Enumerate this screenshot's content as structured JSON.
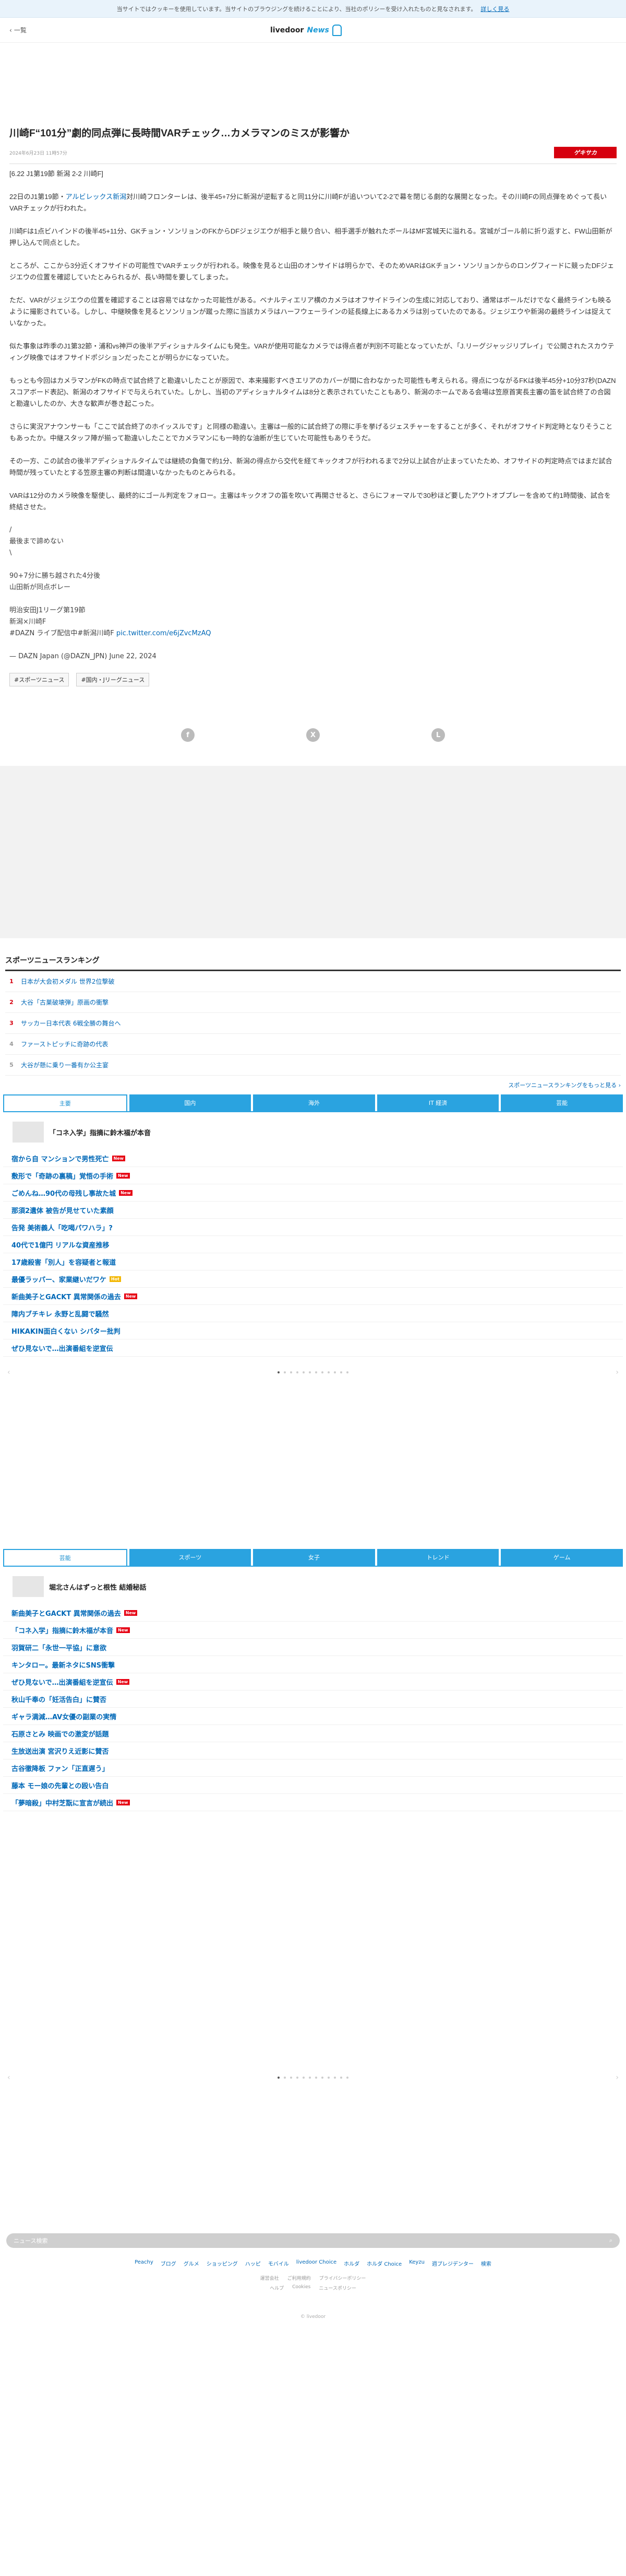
{
  "cookie": {
    "text": "当サイトではクッキーを使用しています。当サイトのブラウジングを続けることにより、当社のポリシーを受け入れたものと見なされます。",
    "link": "詳しく見る"
  },
  "header": {
    "back": "一覧",
    "brand": "livedoor",
    "brand_news": "News"
  },
  "article": {
    "title": "川崎F“101分”劇的同点弾に長時間VARチェック…カメラマンのミスが影響か",
    "date": "2024年6月23日 11時57分",
    "source": "ゲキサカ",
    "lead": "[6.22 J1第19節 新潟 2-2 川崎F]",
    "p1_pre": "22日のJ1第19節・",
    "p1_link": "アルビレックス新潟",
    "p1_post": "対川崎フロンターレは、後半45+7分に新潟が逆転すると同11分に川崎Fが追いついて2-2で幕を閉じる劇的な展開となった。その川崎Fの同点弾をめぐって長いVARチェックが行われた。",
    "p2": "川崎Fは1点ビハインドの後半45+11分、GKチョン・ソンリョンのFKからDFジェジエウが相手と競り合い、相手選手が触れたボールはMF宮城天に溢れる。宮城がゴール前に折り返すと、FW山田新が押し込んで同点とした。",
    "p3": "ところが、ここから3分近くオフサイドの可能性でVARチェックが行われる。映像を見ると山田のオンサイドは明らかで、そのためVARはGKチョン・ソンリョンからのロングフィードに競ったDFジェジエウの位置を確認していたとみられるが、長い時間を要してしまった。",
    "p4": "ただ、VARがジェジエウの位置を確認することは容易ではなかった可能性がある。ベナルティエリア横のカメラはオフサイドラインの生成に対応しており、通常はボールだけでなく最終ラインも映るように撮影されている。しかし、中継映像を見るとソンリョンが蹴った際に当該カメラはハーフウェーラインの延長線上にあるカメラは別っていたのである。ジェジエウや新潟の最終ラインは捉えていなかった。",
    "p5": "似た事象は昨季のJ1第32節・浦和vs神戸の後半アディショナルタイムにも発生。VARが使用可能なカメラでは得点者が判別不可能となっていたが、「J.リーグジャッジリプレイ」で公開されたスカウティング映像ではオフサイドポジションだったことが明らかになっていた。",
    "p6": "もっとも今回はカメラマンがFKの時点で試合終了と勘違いしたことが原因で、本来撮影すべきエリアのカバーが間に合わなかった可能性も考えられる。得点につながるFKは後半45分+10分37秒(DAZNスコアボード表記)、新潟のオフサイドで与えられていた。しかし、当初のアディショナルタイムは8分と表示されていたこともあり、新潟のホームである会場は笠原首実長主審の笛を試合終了の合図と勘違いしたのか、大きな歓声が巻き起こった。",
    "p7": "さらに実況アナウンサーも「ここで試合終了のホイッスルです」と同様の勘違い。主審は一般的に試合終了の際に手を挙げるジェスチャーをすることが多く、それがオフサイド判定時となりそうこともあったか。中継スタッフ陣が揃って勘違いしたことでカメラマンにも一時的な油断が生じていた可能性もありそうだ。",
    "p8": "その一方、この試合の後半アディショナルタイムでは継続の負傷で約1分、新潟の得点から交代を経てキックオフが行われるまで2分以上試合が止まっていたため、オフサイドの判定時点ではまだ試合時間が残っていたとする笠原主審の判断は間違いなかったものとみられる。",
    "p9": "VARは12分のカメラ映像を駆使し、最終的にゴール判定をフォロー。主審はキックオフの笛を吹いて再開させると、さらにフォーマルで30秒ほど要したアウトオブプレーを含めて約1時間後、試合を終結させた。",
    "tweet_l1": "/",
    "tweet_l2": "最後まで諦めない",
    "tweet_l3": "\\",
    "tweet_l4": "90+7分に勝ち越された4分後",
    "tweet_l5": "山田新が同点ボレー",
    "tweet_l6": "明治安田J1リーグ第19節",
    "tweet_l7": "新潟×川崎F",
    "tweet_l8_pre": "#DAZN ライブ配信中#新潟川崎F ",
    "tweet_l8_link": "pic.twitter.com/e6jZvcMzAQ",
    "tweet_l9": "— DAZN Japan (@DAZN_JPN) June 22, 2024",
    "tags": [
      "#スポーツニュース",
      "#国内・Jリーグニュース"
    ]
  },
  "share": {
    "fb": "f",
    "x": "X",
    "line": "L"
  },
  "ranking": {
    "title": "スポーツニュースランキング",
    "items": [
      {
        "no": "1",
        "text": "日本が大会初メダル 世界2位撃破"
      },
      {
        "no": "2",
        "text": "大谷「古巣破壊弾」原画の衝撃"
      },
      {
        "no": "3",
        "text": "サッカー日本代表 6戦全勝の舞台へ"
      },
      {
        "no": "4",
        "text": "ファーストピッチに奇跡の代表"
      },
      {
        "no": "5",
        "text": "大谷が懸に乗り一番有か公主宴"
      }
    ],
    "more": "スポーツニュースランキングをもっと見る ›"
  },
  "tabs1": [
    "主要",
    "国内",
    "海外",
    "IT 経済",
    "芸能"
  ],
  "topics1": {
    "head": "「コネ入学」指摘に鈴木福が本音",
    "items": [
      {
        "text": "宿から自 マンションで男性死亡",
        "badge": "new"
      },
      {
        "text": "敷形で「奇跡の裏稿」覚悟の手術",
        "badge": "new"
      },
      {
        "text": "ごめんね…90代の母残し事故た城",
        "badge": "new"
      },
      {
        "text": "那須2遺体 被告が見せていた素顔",
        "badge": ""
      },
      {
        "text": "告発 美術義人「吃喝パワハラ」?",
        "badge": ""
      },
      {
        "text": "40代で1億円 リアルな資産推移",
        "badge": ""
      },
      {
        "text": "17歳殺害「別人」を容疑者と報道",
        "badge": ""
      },
      {
        "text": "最優ラッパー、家業継いだワケ",
        "badge": "hot"
      },
      {
        "text": "新曲美子とGACKT 異常関係の過去",
        "badge": "new"
      },
      {
        "text": "障内ブチキレ 永野と乱闘で騒然",
        "badge": ""
      },
      {
        "text": "HIKAKIN面白くない シバター批判",
        "badge": ""
      },
      {
        "text": "ぜひ見ないで…出演番組を逆宣伝",
        "badge": ""
      }
    ]
  },
  "tabs2": [
    "芸能",
    "スポーツ",
    "女子",
    "トレンド",
    "ゲーム"
  ],
  "topics2": {
    "head": "堀北さんはずっと根性 結婚秘話",
    "items": [
      {
        "text": "新曲美子とGACKT 異常関係の過去",
        "badge": "new"
      },
      {
        "text": "「コネ入学」指摘に鈴木福が本音",
        "badge": "new"
      },
      {
        "text": "羽賀研二「永世一平協」に意欲",
        "badge": ""
      },
      {
        "text": "キンタロー。最新ネタにSNS衝撃",
        "badge": ""
      },
      {
        "text": "ぜひ見ないで…出演番組を逆宣伝",
        "badge": "new"
      },
      {
        "text": "秋山千奉の「妊活告白」に賛否",
        "badge": ""
      },
      {
        "text": "ギャラ満減…AV女優の副業の実情",
        "badge": ""
      },
      {
        "text": "石原さとみ 映画での激変が話題",
        "badge": ""
      },
      {
        "text": "生放送出演 宮沢りえ近影に賛否",
        "badge": ""
      },
      {
        "text": "古谷徹降板 ファン「正直遅う」",
        "badge": ""
      },
      {
        "text": "藤本 モー娘の先輩との殴い告白",
        "badge": ""
      },
      {
        "text": "「夢暗殺」中村芝翫に宣言が続出",
        "badge": "new"
      }
    ]
  },
  "badges": {
    "new": "New",
    "hot": "Hot"
  },
  "footer": {
    "search_placeholder": "ニュース検索",
    "links": [
      "Peachy",
      "ブログ",
      "グルメ",
      "ショッピング",
      "ハッピ",
      "モバイル",
      "livedoor Choice",
      "ホルダ",
      "ホルダ Choice",
      "Keyzu",
      "週プレジデンター",
      "検索"
    ],
    "sub1": [
      "運営会社",
      "ご利用規約",
      "プライバシーポリシー"
    ],
    "sub2": [
      "ヘルプ",
      "Cookies",
      "ニュースポリシー"
    ],
    "copyright": "© livedoor"
  }
}
